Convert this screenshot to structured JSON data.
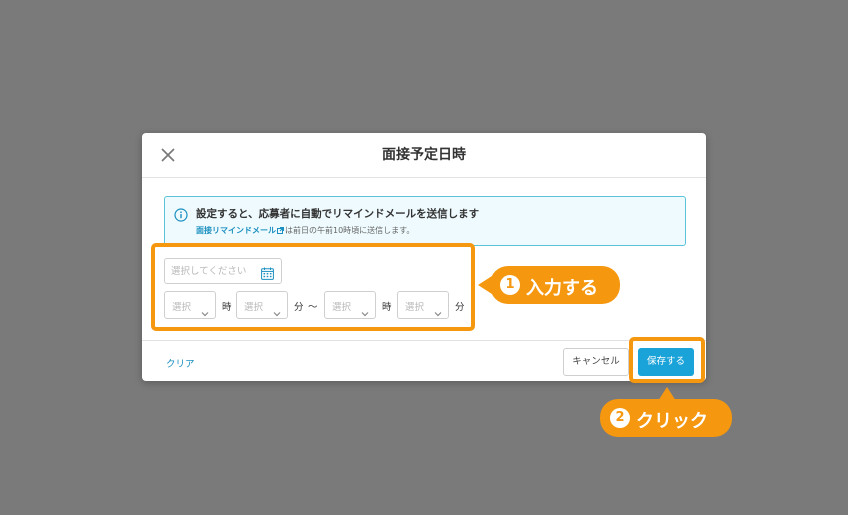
{
  "dialog": {
    "title": "面接予定日時",
    "close_icon": "close-icon"
  },
  "info": {
    "icon": "info-icon",
    "title": "設定すると、応募者に自動でリマインドメールを送信します",
    "link_label": "面接リマインドメール",
    "link_icon": "external-link-icon",
    "note": "は前日の午前10時頃に送信します。"
  },
  "form": {
    "date_placeholder": "選択してください",
    "calendar_icon": "calendar-icon",
    "start_hour": "選択",
    "hour_unit": "時",
    "start_minute": "選択",
    "minute_unit": "分",
    "range_separator": "〜",
    "end_hour": "選択",
    "end_minute": "選択"
  },
  "footer": {
    "clear_label": "クリア",
    "cancel_label": "キャンセル",
    "save_label": "保存する"
  },
  "annotations": {
    "step1_number": "1",
    "step1_label": "入力する",
    "step2_number": "2",
    "step2_label": "クリック",
    "accent_color": "#f5970f"
  },
  "colors": {
    "primary": "#1aa3d9",
    "link": "#1a8fc0",
    "info_border": "#5bc2da",
    "overlay": "#7a7a7a"
  }
}
